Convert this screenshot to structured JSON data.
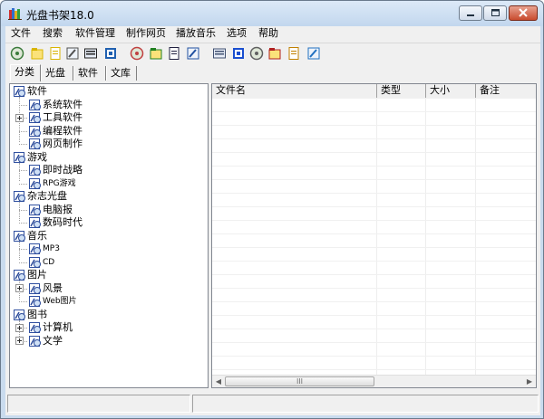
{
  "window": {
    "title": "光盘书架18.0"
  },
  "menu": [
    "文件",
    "搜索",
    "软件管理",
    "制作网页",
    "播放音乐",
    "选项",
    "帮助"
  ],
  "toolbar": {
    "buttons": [
      {
        "name": "cd-icon",
        "color": "#3a7a3a"
      },
      {
        "name": "new-folder-icon",
        "color": "#d9b400"
      },
      {
        "name": "new-item-icon",
        "color": "#d9b400"
      },
      {
        "name": "edit-pencil-icon",
        "color": "#505050"
      },
      {
        "name": "binoculars-icon",
        "color": "#202020"
      },
      {
        "name": "disc-scan-icon",
        "color": "#2060b0"
      },
      {
        "name": "report-icon",
        "color": "#c04040"
      },
      {
        "name": "list-icon",
        "color": "#208020"
      },
      {
        "name": "save-icon",
        "color": "#202040"
      },
      {
        "name": "web-icon",
        "color": "#2050a0"
      },
      {
        "name": "table-icon",
        "color": "#405070"
      },
      {
        "name": "download-arrow-icon",
        "color": "#1a4fd0"
      },
      {
        "name": "settings-disc-icon",
        "color": "#606060"
      },
      {
        "name": "bullet-list-icon",
        "color": "#b02020"
      },
      {
        "name": "help-icon",
        "color": "#c08000"
      },
      {
        "name": "exit-icon",
        "color": "#2070c0"
      }
    ]
  },
  "tabs": [
    "分类",
    "光盘",
    "软件",
    "文库"
  ],
  "tree": {
    "groups": [
      {
        "label": "软件",
        "children": [
          {
            "label": "系统软件",
            "expander": false
          },
          {
            "label": "工具软件",
            "expander": true
          },
          {
            "label": "编程软件",
            "expander": false
          },
          {
            "label": "网页制作",
            "expander": false
          }
        ]
      },
      {
        "label": "游戏",
        "children": [
          {
            "label": "即时战略",
            "expander": false
          },
          {
            "label": "RPG游戏",
            "expander": false
          }
        ]
      },
      {
        "label": "杂志光盘",
        "children": [
          {
            "label": "电脑报",
            "expander": false
          },
          {
            "label": "数码时代",
            "expander": false
          }
        ]
      },
      {
        "label": "音乐",
        "children": [
          {
            "label": "MP3",
            "expander": false
          },
          {
            "label": "CD",
            "expander": false
          }
        ]
      },
      {
        "label": "图片",
        "children": [
          {
            "label": "风景",
            "expander": true
          },
          {
            "label": "Web图片",
            "expander": false
          }
        ]
      },
      {
        "label": "图书",
        "children": [
          {
            "label": "计算机",
            "expander": true
          },
          {
            "label": "文学",
            "expander": true
          }
        ]
      }
    ]
  },
  "list": {
    "columns": [
      "文件名",
      "类型",
      "大小",
      "备注"
    ]
  },
  "scrollbar": {
    "thumb_grip": "III"
  },
  "colors": {
    "titlebar": "#c9dbee",
    "close": "#c94b2e",
    "window_bg": "#f0f0f0"
  }
}
